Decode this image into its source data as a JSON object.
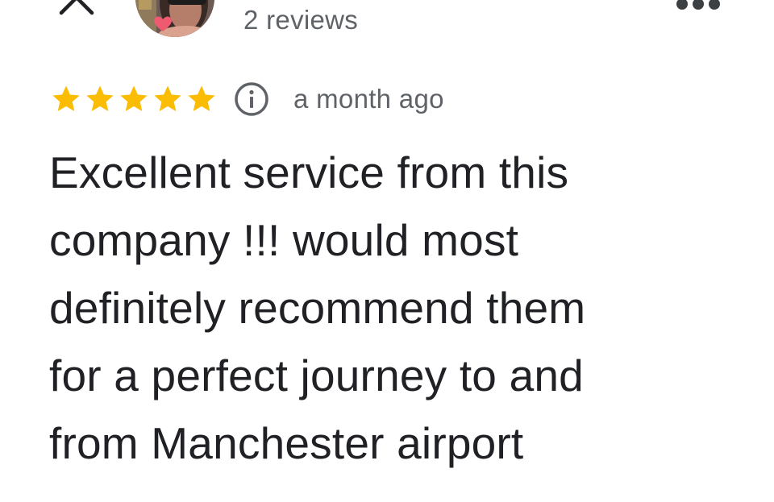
{
  "header": {
    "close_icon": "close-icon",
    "more_icon": "more-horizontal-icon",
    "reviewer": {
      "review_count": "2 reviews"
    }
  },
  "review": {
    "rating": 5,
    "rating_max": 5,
    "star_color": "#fbbc04",
    "info_icon": "info-icon",
    "date": "a month ago",
    "text_lines": [
      "Excellent service from this",
      "company !!! would most",
      "definitely recommend them",
      "for a perfect journey to and",
      "from Manchester airport"
    ]
  },
  "colors": {
    "text_primary": "#202124",
    "text_secondary": "#5f6368",
    "icon": "#3c4043"
  }
}
